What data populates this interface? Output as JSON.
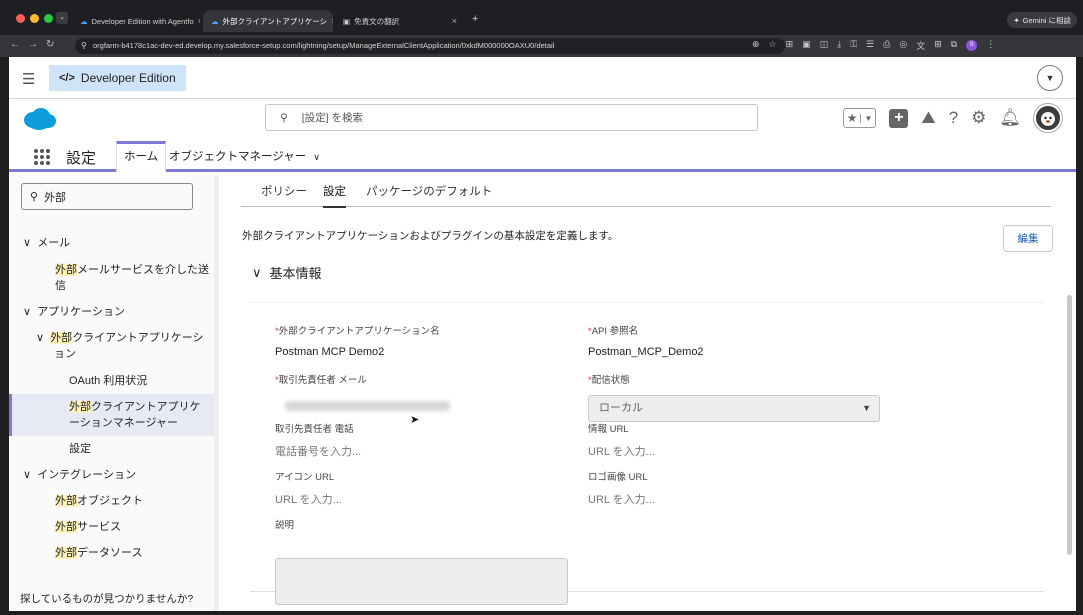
{
  "browser": {
    "tabs": [
      {
        "label": "Developer Edition with Agentfo"
      },
      {
        "label": "外部クライアントアプリケーシ"
      },
      {
        "label": "免責文の翻訳"
      }
    ],
    "new_tab": "+",
    "gemini_label": "Gemini に相談",
    "url": "orgfarm-b4178c1ac-dev-ed.develop.my.salesforce-setup.com/lightning/setup/ManageExternalClientApplication/0xkdM000000OAXU0/detail"
  },
  "app_bar": {
    "org_label": "Developer Edition",
    "org_icon": "</>"
  },
  "header": {
    "search_placeholder": "[設定] を検索"
  },
  "setup_nav": {
    "title": "設定",
    "home_tab": "ホーム",
    "object_manager": "オブジェクトマネージャー"
  },
  "sidebar": {
    "quick_find_value": "外部",
    "items": [
      {
        "chevron": "∨",
        "label": "メール"
      },
      {
        "hl": "外部",
        "rest": "メールサービスを介した送",
        "rest2": "信"
      },
      {
        "chevron": "∨",
        "label": "アプリケーション"
      },
      {
        "chevron": "∨",
        "hl": "外部",
        "rest": "クライアントアプリケーシ",
        "rest2": "ョン"
      },
      {
        "label": "OAuth 利用状況"
      },
      {
        "hl": "外部",
        "rest": "クライアントアプリケ",
        "rest2": "ーションマネージャー"
      },
      {
        "label": "設定"
      },
      {
        "chevron": "∨",
        "label": "インテグレーション"
      },
      {
        "hl": "外部",
        "rest": "オブジェクト"
      },
      {
        "hl": "外部",
        "rest": "サービス"
      },
      {
        "hl": "外部",
        "rest": "データソース"
      }
    ],
    "footer": "探しているものが見つかりませんか?"
  },
  "main": {
    "tabs": [
      "ポリシー",
      "設定",
      "パッケージのデフォルト"
    ],
    "description": "外部クライアントアプリケーションおよびプラグインの基本設定を定義します。",
    "edit_label": "編集",
    "section_title": "基本情報",
    "fields": {
      "app_name_label": "外部クライアントアプリケーション名",
      "app_name_value": "Postman MCP Demo2",
      "api_name_label": "API 参照名",
      "api_name_value": "Postman_MCP_Demo2",
      "contact_email_label": "取引先責任者 メール",
      "distribution_label": "配信状態",
      "distribution_value": "ローカル",
      "contact_phone_label": "取引先責任者 電話",
      "contact_phone_placeholder": "電話番号を入力...",
      "info_url_label": "情報 URL",
      "info_url_placeholder": "URL を入力...",
      "icon_url_label": "アイコン URL",
      "icon_url_placeholder": "URL を入力...",
      "logo_url_label": "ロゴ画像 URL",
      "logo_url_placeholder": "URL を入力...",
      "description_label": "説明"
    }
  }
}
